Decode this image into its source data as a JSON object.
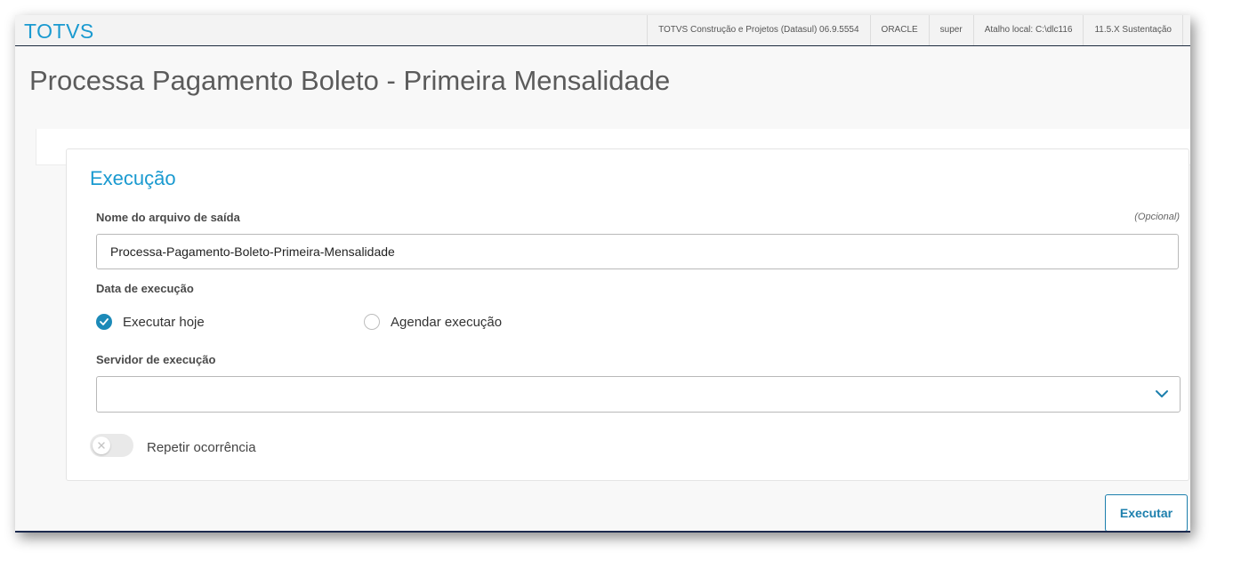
{
  "header": {
    "logo": "TOTVS",
    "info": [
      "TOTVS Construção e Projetos (Datasul) 06.9.5554",
      "ORACLE",
      "super",
      "Atalho local: C:\\dlc116",
      "11.5.X Sustentação"
    ]
  },
  "page": {
    "title": "Processa Pagamento Boleto - Primeira Mensalidade"
  },
  "execution": {
    "title": "Execução",
    "output_file": {
      "label": "Nome do arquivo de saída",
      "optional": "(Opcional)",
      "value": "Processa-Pagamento-Boleto-Primeira-Mensalidade"
    },
    "date": {
      "label": "Data de execução",
      "options": [
        {
          "label": "Executar hoje",
          "checked": true
        },
        {
          "label": "Agendar execução",
          "checked": false
        }
      ]
    },
    "server": {
      "label": "Servidor de execução",
      "value": ""
    },
    "repeat": {
      "label": "Repetir ocorrência",
      "enabled": false
    }
  },
  "actions": {
    "execute_label": "Executar"
  },
  "colors": {
    "brand": "#1a9ad0",
    "radio_checked": "#1c8ab8",
    "button": "#1c7fad"
  }
}
